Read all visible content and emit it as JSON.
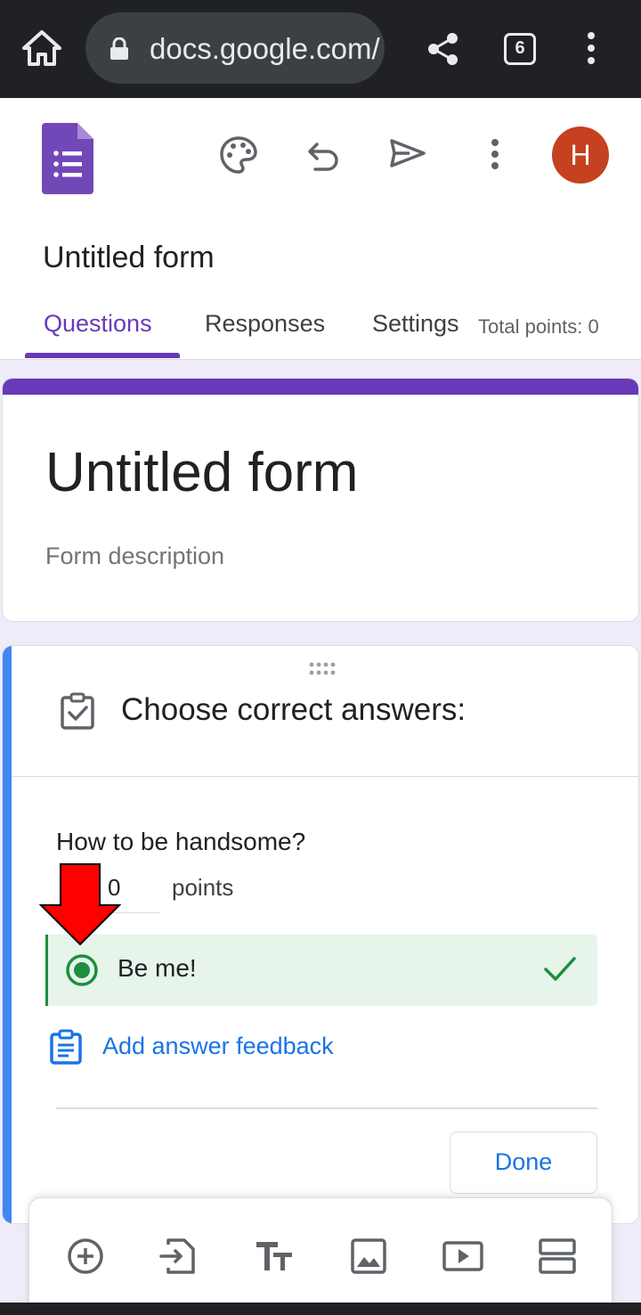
{
  "browser": {
    "url": "docs.google.com/",
    "tab_count": "6",
    "icons": [
      "home-icon",
      "lock-icon",
      "share-icon",
      "tab-switcher-icon",
      "more-vert-icon"
    ]
  },
  "header": {
    "doc_title": "Untitled form",
    "avatar_initial": "H",
    "icons": [
      "google-forms-logo",
      "palette-icon",
      "undo-icon",
      "send-icon",
      "more-vert-icon"
    ],
    "tabs": [
      {
        "label": "Questions",
        "active": true
      },
      {
        "label": "Responses",
        "active": false
      },
      {
        "label": "Settings",
        "active": false
      }
    ],
    "total_points": "Total points: 0"
  },
  "title_card": {
    "title": "Untitled form",
    "description_placeholder": "Form description"
  },
  "question_card": {
    "answer_key_title": "Choose correct answers:",
    "question": "How to be handsome?",
    "points_value": "0",
    "points_label": "points",
    "correct_option": "Be me!",
    "feedback_link": "Add answer feedback",
    "done_label": "Done"
  },
  "toolbar": {
    "tools": [
      "add-question-icon",
      "import-questions-icon",
      "add-title-icon",
      "add-image-icon",
      "add-video-icon",
      "add-section-icon"
    ]
  },
  "colors": {
    "accent_purple": "#673ab7",
    "link_blue": "#1a73e8",
    "correct_green": "#1e8e3e",
    "correct_bg": "#e6f4ea",
    "avatar_bg": "#c5411f",
    "annotation_red": "#ff0000",
    "page_bg": "#f0ebf8"
  }
}
